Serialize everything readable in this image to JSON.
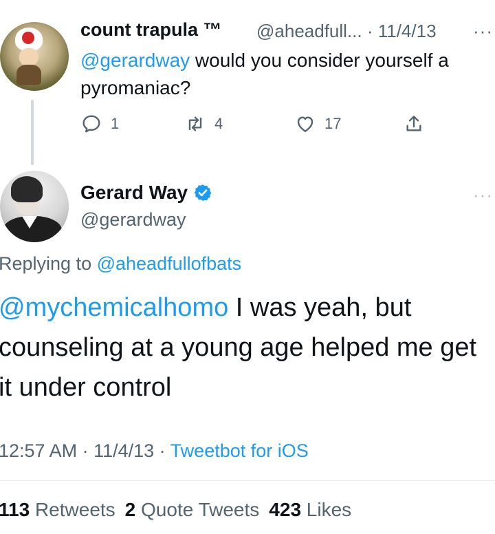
{
  "parent_tweet": {
    "author_name": "count trapula ™",
    "handle_date": "@aheadfull... · 11/4/13",
    "more": "···",
    "mention": "@gerardway",
    "text": " would you consider yourself a pyromaniac?",
    "actions": {
      "reply_count": "1",
      "retweet_count": "4",
      "like_count": "17"
    }
  },
  "reply_tweet": {
    "author_name": "Gerard Way",
    "handle": "@gerardway",
    "more": "···",
    "replying_prefix": "Replying to ",
    "replying_handle": "@aheadfullofbats",
    "mention": "@mychemicalhomo",
    "text": " I was yeah, but counseling at a young age helped me get it under control",
    "time_date": "12:57 AM · 11/4/13 · ",
    "source": "Tweetbot for iOS",
    "stats": {
      "retweets_count": "113",
      "retweets_label": "Retweets",
      "quotes_count": "2",
      "quotes_label": "Quote Tweets",
      "likes_count": "423",
      "likes_label": "Likes"
    }
  },
  "colors": {
    "link": "#1d9bf0",
    "secondary": "#536471",
    "text": "#0f1419"
  }
}
